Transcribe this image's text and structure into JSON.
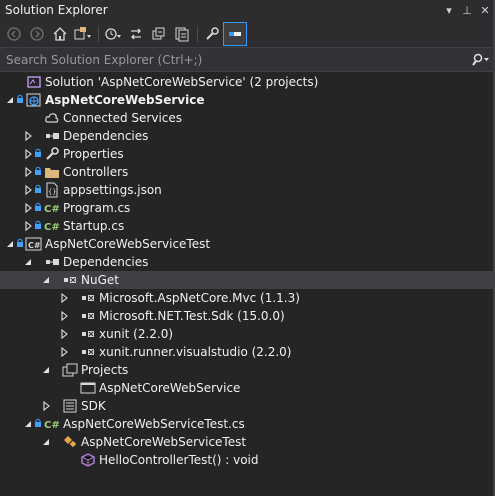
{
  "window": {
    "title": "Solution Explorer"
  },
  "titlebar_buttons": [
    "▾",
    "⊥",
    "✕"
  ],
  "search": {
    "placeholder": "Search Solution Explorer (Ctrl+;)"
  },
  "tree": [
    {
      "label": "Solution 'AspNetCoreWebService' (2 projects)",
      "icon": "solution-icon",
      "expander": "",
      "lock": false
    },
    {
      "label": "AspNetCoreWebService",
      "icon": "web-project-icon",
      "expander": "expanded",
      "lock": true,
      "bold": true
    },
    {
      "label": "Connected Services",
      "icon": "cloud-icon",
      "expander": "",
      "lock": false
    },
    {
      "label": "Dependencies",
      "icon": "dependencies-icon",
      "expander": "collapsed",
      "lock": false
    },
    {
      "label": "Properties",
      "icon": "wrench-icon",
      "expander": "collapsed",
      "lock": true
    },
    {
      "label": "Controllers",
      "icon": "folder-icon",
      "expander": "collapsed",
      "lock": true
    },
    {
      "label": "appsettings.json",
      "icon": "json-file-icon",
      "expander": "collapsed",
      "lock": true
    },
    {
      "label": "Program.cs",
      "icon": "csharp-file-icon",
      "expander": "collapsed",
      "lock": true
    },
    {
      "label": "Startup.cs",
      "icon": "csharp-file-icon",
      "expander": "collapsed",
      "lock": true
    },
    {
      "label": "AspNetCoreWebServiceTest",
      "icon": "csharp-project-icon",
      "expander": "expanded",
      "lock": true
    },
    {
      "label": "Dependencies",
      "icon": "dependencies-icon",
      "expander": "expanded",
      "lock": false
    },
    {
      "label": "NuGet",
      "icon": "package-icon",
      "expander": "expanded",
      "lock": false,
      "selected": true
    },
    {
      "label": "Microsoft.AspNetCore.Mvc (1.1.3)",
      "icon": "package-icon",
      "expander": "collapsed",
      "lock": false
    },
    {
      "label": "Microsoft.NET.Test.Sdk (15.0.0)",
      "icon": "package-icon",
      "expander": "collapsed",
      "lock": false
    },
    {
      "label": "xunit (2.2.0)",
      "icon": "package-icon",
      "expander": "collapsed",
      "lock": false
    },
    {
      "label": "xunit.runner.visualstudio (2.2.0)",
      "icon": "package-icon",
      "expander": "collapsed",
      "lock": false
    },
    {
      "label": "Projects",
      "icon": "projects-icon",
      "expander": "expanded",
      "lock": false
    },
    {
      "label": "AspNetCoreWebService",
      "icon": "project-reference-icon",
      "expander": "",
      "lock": false
    },
    {
      "label": "SDK",
      "icon": "sdk-icon",
      "expander": "collapsed",
      "lock": false
    },
    {
      "label": "AspNetCoreWebServiceTest.cs",
      "icon": "csharp-file-icon",
      "expander": "expanded",
      "lock": true
    },
    {
      "label": "AspNetCoreWebServiceTest",
      "icon": "class-icon",
      "expander": "expanded",
      "lock": false
    },
    {
      "label": "HelloControllerTest() : void",
      "icon": "method-icon",
      "expander": "",
      "lock": false
    }
  ]
}
